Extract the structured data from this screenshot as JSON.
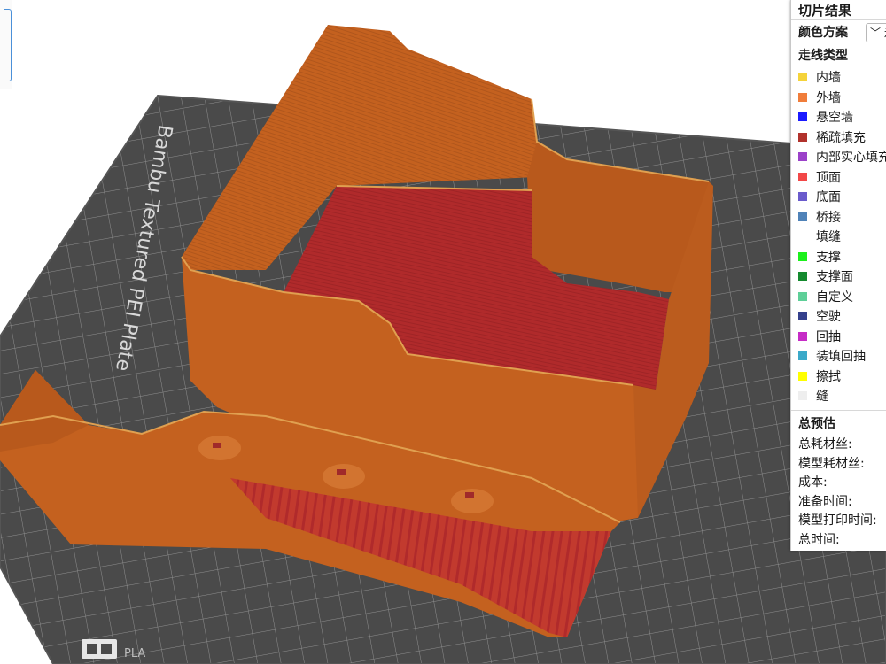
{
  "legend": {
    "title": "切片结果",
    "scheme_label": "颜色方案",
    "scheme_value": "走",
    "line_type_heading": "走线类型",
    "items": [
      {
        "label": "内墙",
        "color": "#f5d33a"
      },
      {
        "label": "外墙",
        "color": "#f07d3a"
      },
      {
        "label": "悬空墙",
        "color": "#1a1aff"
      },
      {
        "label": "稀疏填充",
        "color": "#b1322c"
      },
      {
        "label": "内部实心填充",
        "color": "#9b41c9"
      },
      {
        "label": "顶面",
        "color": "#f24747"
      },
      {
        "label": "底面",
        "color": "#6a5bcc"
      },
      {
        "label": "桥接",
        "color": "#4f82b8"
      },
      {
        "label": "填缝",
        "color": "#ffffff"
      },
      {
        "label": "支撑",
        "color": "#1cf01c"
      },
      {
        "label": "支撑面",
        "color": "#148a2e"
      },
      {
        "label": "自定义",
        "color": "#5ecf98"
      },
      {
        "label": "空驶",
        "color": "#34408c"
      },
      {
        "label": "回抽",
        "color": "#c62cc6"
      },
      {
        "label": "装填回抽",
        "color": "#3aa9c9"
      },
      {
        "label": "擦拭",
        "color": "#ffff00"
      },
      {
        "label": "缝",
        "color": "#eeeeee"
      }
    ],
    "summary_heading": "总预估",
    "stats": [
      "总耗材丝:",
      "模型耗材丝:",
      "成本:",
      "准备时间:",
      "模型打印时间:",
      "总时间:"
    ]
  },
  "plate": {
    "label": "Bambu Textured PEI Plate",
    "bottom_text": "PLA"
  },
  "colors": {
    "plate": "#4a4a4a",
    "grid": "#9a9a9a",
    "wall": "#c4611f",
    "wall_dark": "#a9501a",
    "floor": "#b0282a",
    "highlight": "#e09a4a"
  }
}
